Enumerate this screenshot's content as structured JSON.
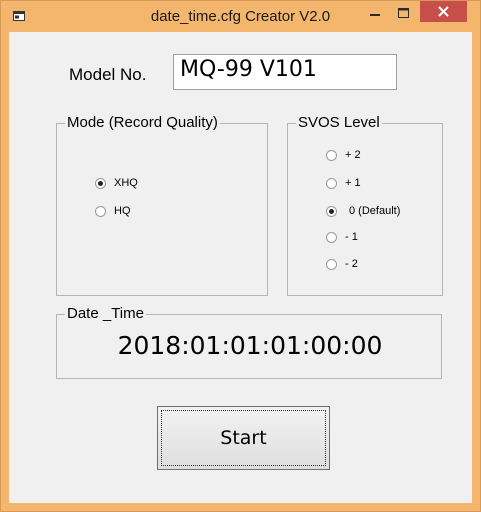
{
  "window": {
    "title": "date_time.cfg Creator V2.0",
    "frame_color": "#f4b56c",
    "close_color": "#c74f4a"
  },
  "model": {
    "label": "Model No.",
    "value": "MQ-99 V101"
  },
  "mode_group": {
    "legend": "Mode (Record Quality)",
    "options": [
      {
        "label": "XHQ",
        "selected": true
      },
      {
        "label": "HQ",
        "selected": false
      }
    ]
  },
  "svos_group": {
    "legend": "SVOS Level",
    "options": [
      {
        "label": "+ 2",
        "selected": false
      },
      {
        "label": "+ 1",
        "selected": false
      },
      {
        "label": "0 (Default)",
        "selected": true
      },
      {
        "label": "- 1",
        "selected": false
      },
      {
        "label": "- 2",
        "selected": false
      }
    ]
  },
  "date_group": {
    "legend": "Date _Time",
    "value": "2018:01:01:01:00:00"
  },
  "start_button": {
    "label": "Start"
  }
}
